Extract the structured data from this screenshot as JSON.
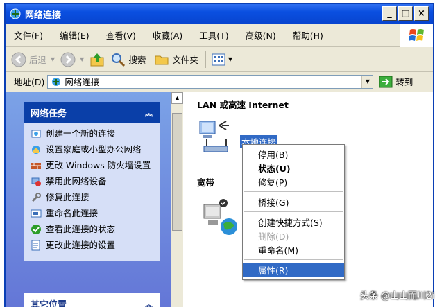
{
  "window": {
    "title": "网络连接"
  },
  "menu": [
    "文件(F)",
    "编辑(E)",
    "查看(V)",
    "收藏(A)",
    "工具(T)",
    "高级(N)",
    "帮助(H)"
  ],
  "toolbar": {
    "back": "后退",
    "search": "搜索",
    "folders": "文件夹"
  },
  "address": {
    "label": "地址(D)",
    "value": "网络连接",
    "go": "转到"
  },
  "tasks": {
    "title": "网络任务",
    "items": [
      {
        "icon": "new-connection-icon",
        "label": "创建一个新的连接"
      },
      {
        "icon": "home-network-icon",
        "label": "设置家庭或小型办公网络"
      },
      {
        "icon": "firewall-icon",
        "label": "更改 Windows 防火墙设置"
      },
      {
        "icon": "disable-device-icon",
        "label": "禁用此网络设备"
      },
      {
        "icon": "repair-icon",
        "label": "修复此连接"
      },
      {
        "icon": "rename-icon",
        "label": "重命名此连接"
      },
      {
        "icon": "status-icon",
        "label": "查看此连接的状态"
      },
      {
        "icon": "settings-icon",
        "label": "更改此连接的设置"
      }
    ]
  },
  "other_places": {
    "title": "其它位置"
  },
  "content": {
    "lan_group": "LAN 或高速 Internet",
    "lan_item": "本地连接",
    "broadband_group": "宽带"
  },
  "context_menu": [
    {
      "label": "停用(B)",
      "style": "normal"
    },
    {
      "label": "状态(U)",
      "style": "bold"
    },
    {
      "label": "修复(P)",
      "style": "normal"
    },
    {
      "label": "桥接(G)",
      "style": "normal"
    },
    {
      "label": "创建快捷方式(S)",
      "style": "normal"
    },
    {
      "label": "删除(D)",
      "style": "disabled"
    },
    {
      "label": "重命名(M)",
      "style": "normal"
    },
    {
      "label": "属性(R)",
      "style": "selected"
    }
  ],
  "watermark": "头条 @山山而川2i"
}
